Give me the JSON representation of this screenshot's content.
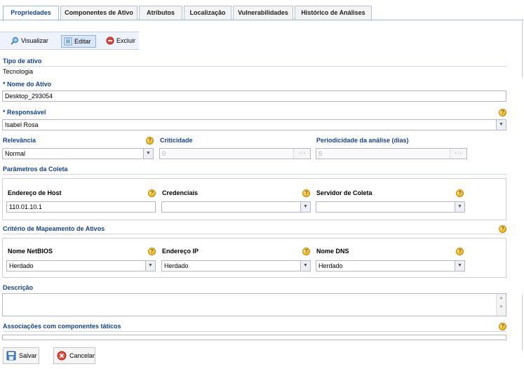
{
  "tabs": [
    "Propriedades",
    "Componentes de Ativo",
    "Atributos",
    "Localização",
    "Vulnerabilidades",
    "Histórico de Análises"
  ],
  "toolbar": {
    "view": "Visualizar",
    "edit": "Editar",
    "delete": "Excluir"
  },
  "tipo": {
    "label": "Tipo de ativo",
    "value": "Tecnologia"
  },
  "nome": {
    "label": "* Nome do Ativo",
    "value": "Desktop_293054"
  },
  "responsavel": {
    "label": "* Responsável",
    "value": "Isabel Rosa"
  },
  "relevancia": {
    "label": "Relevância",
    "value": "Normal"
  },
  "criticidade": {
    "label": "Criticidade",
    "value": "0"
  },
  "periodicidade": {
    "label": "Periodicidade da análise (dias)",
    "value": "0"
  },
  "coleta": {
    "section": "Parâmetros da Coleta",
    "host_label": "Endereço de Host",
    "host_value": "110.01.10.1",
    "cred_label": "Credenciais",
    "cred_value": "",
    "server_label": "Servidor de Coleta",
    "server_value": ""
  },
  "mapeamento": {
    "section": "Critério de Mapeamento de Ativos",
    "netbios_label": "Nome NetBIOS",
    "netbios_value": "Herdado",
    "ip_label": "Endereço IP",
    "ip_value": "Herdado",
    "dns_label": "Nome DNS",
    "dns_value": "Herdado"
  },
  "descricao": {
    "label": "Descrição",
    "value": ""
  },
  "associacoes": {
    "label": "Associações com componentes táticos"
  },
  "buttons": {
    "save": "Salvar",
    "cancel": "Cancelar"
  },
  "colors": {
    "accent": "#15428b",
    "border": "#99bbe8",
    "help": "#e0a100"
  }
}
